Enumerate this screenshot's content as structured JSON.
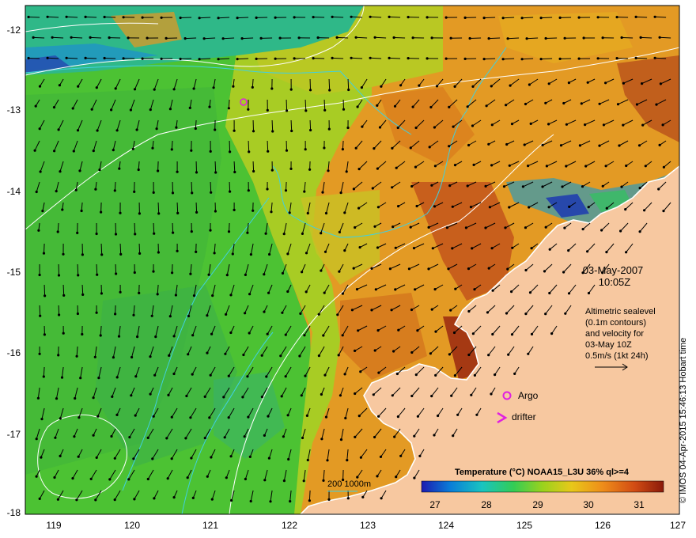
{
  "map": {
    "date_label": "03-May-2007",
    "time_label": "10:05Z",
    "info_lines": [
      "Altimetric sealevel",
      "(0.1m contours)",
      "and velocity for",
      "03-May 10Z",
      "0.5m/s (1kt 24h)"
    ],
    "legend": {
      "argo": "Argo",
      "drifter": "drifter",
      "depth_contours": "200  1000m"
    },
    "colorbar": {
      "title": "Temperature (°C) NOAA15_L3U 36% ql>=4",
      "ticks": [
        "27",
        "28",
        "29",
        "30",
        "31"
      ]
    },
    "credit": "© IMOS 04-Apr-2015 15:46:13 Hobart time",
    "x_ticks": [
      "119",
      "120",
      "121",
      "122",
      "123",
      "124",
      "125",
      "126",
      "127"
    ],
    "y_ticks": [
      "-12",
      "-13",
      "-14",
      "-15",
      "-16",
      "-17",
      "-18"
    ],
    "colors": {
      "land": "#f7c8a0",
      "coast": "#ffffff",
      "argo_marker": "#e020e0",
      "drifter_marker": "#e020e0",
      "isobath": "#40d0e0",
      "sealevel_contour": "#ffffff"
    },
    "colorbar_stops": [
      "#1b1bb0",
      "#0a7ed8",
      "#19c4c0",
      "#33cc55",
      "#9ad21d",
      "#e8c81a",
      "#ee8c1a",
      "#d24c14",
      "#8a1a0a"
    ]
  }
}
